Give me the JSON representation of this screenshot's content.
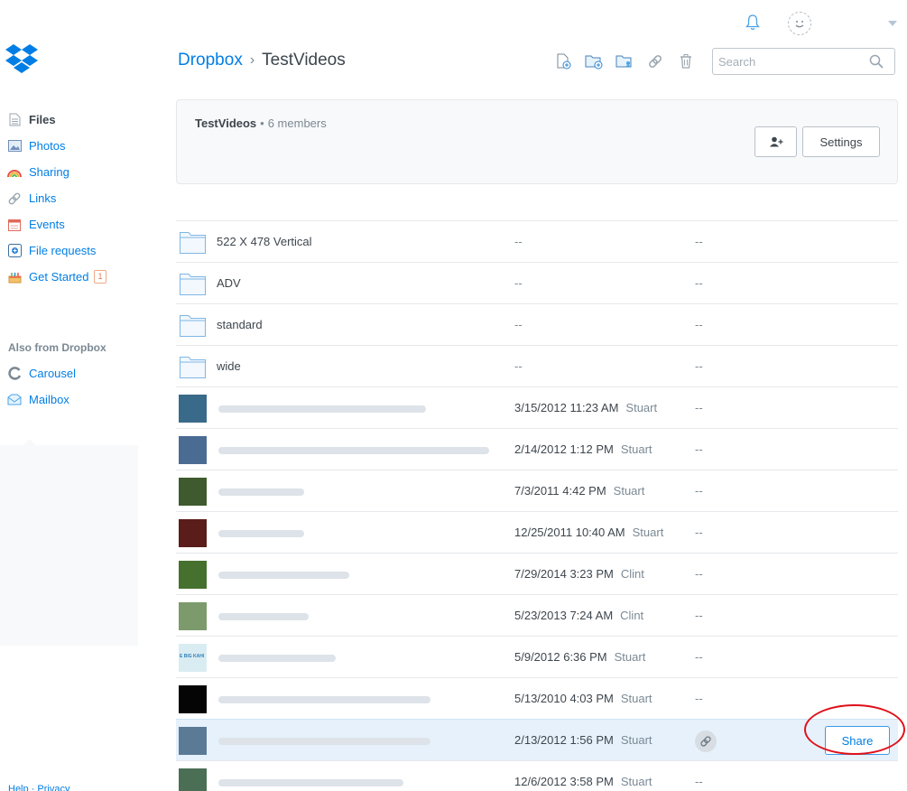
{
  "app": {
    "name": "Dropbox"
  },
  "colors": {
    "accent": "#007ee5",
    "selected_row": "#e6f1fb",
    "annotation_ring": "#e0101a"
  },
  "topbar": {
    "icons": [
      "bell-icon",
      "avatar",
      "chevron-down-icon"
    ]
  },
  "sidebar": {
    "items": [
      {
        "label": "Files",
        "icon": "file-icon",
        "active": true
      },
      {
        "label": "Photos",
        "icon": "photo-icon"
      },
      {
        "label": "Sharing",
        "icon": "rainbow-icon"
      },
      {
        "label": "Links",
        "icon": "link-icon"
      },
      {
        "label": "Events",
        "icon": "calendar-icon"
      },
      {
        "label": "File requests",
        "icon": "file-request-icon"
      },
      {
        "label": "Get Started",
        "icon": "cake-icon",
        "badge": "1"
      }
    ],
    "also_heading": "Also from Dropbox",
    "also_items": [
      {
        "label": "Carousel",
        "icon": "carousel-icon"
      },
      {
        "label": "Mailbox",
        "icon": "mailbox-icon"
      }
    ],
    "footer_text": "Help · Privacy"
  },
  "header": {
    "breadcrumb_root": "Dropbox",
    "breadcrumb_separator": "›",
    "breadcrumb_current": "TestVideos",
    "tools": [
      "upload-file-icon",
      "new-folder-icon",
      "shared-folder-icon",
      "link-icon",
      "trash-icon"
    ],
    "search_placeholder": "Search"
  },
  "banner": {
    "folder_name": "TestVideos",
    "separator": "•",
    "members": "6 members",
    "invite_icon": "add-member-icon",
    "settings_label": "Settings"
  },
  "files": [
    {
      "type": "folder",
      "name": "522 X 478 Vertical",
      "modified": "--",
      "who": "",
      "shared": "--"
    },
    {
      "type": "folder",
      "name": "ADV",
      "modified": "--",
      "who": "",
      "shared": "--"
    },
    {
      "type": "folder",
      "name": "standard",
      "modified": "--",
      "who": "",
      "shared": "--"
    },
    {
      "type": "folder",
      "name": "wide",
      "modified": "--",
      "who": "",
      "shared": "--"
    },
    {
      "type": "video",
      "modified": "3/15/2012 11:23 AM",
      "who": "Stuart",
      "shared": "--",
      "thumb": "#3a6a8a"
    },
    {
      "type": "video",
      "modified": "2/14/2012 1:12 PM",
      "who": "Stuart",
      "shared": "--",
      "thumb": "#4a6c93"
    },
    {
      "type": "video",
      "modified": "7/3/2011 4:42 PM",
      "who": "Stuart",
      "shared": "--",
      "thumb": "#3f5a2e"
    },
    {
      "type": "video",
      "modified": "12/25/2011 10:40 AM",
      "who": "Stuart",
      "shared": "--",
      "thumb": "#5a1d1a"
    },
    {
      "type": "video",
      "modified": "7/29/2014 3:23 PM",
      "who": "Clint",
      "shared": "--",
      "thumb": "#46702e"
    },
    {
      "type": "video",
      "modified": "5/23/2013 7:24 AM",
      "who": "Clint",
      "shared": "--",
      "thumb": "#7c9a6c"
    },
    {
      "type": "video",
      "modified": "5/9/2012 6:36 PM",
      "who": "Stuart",
      "shared": "--",
      "thumb": "#d9ecf2",
      "thumb_text": "E BIG KAHI"
    },
    {
      "type": "video",
      "modified": "5/13/2010 4:03 PM",
      "who": "Stuart",
      "shared": "--",
      "thumb": "#050505"
    },
    {
      "type": "video",
      "modified": "2/13/2012 1:56 PM",
      "who": "Stuart",
      "shared": "link",
      "thumb": "#5a7a96",
      "selected": true,
      "action": "Share"
    },
    {
      "type": "video",
      "modified": "12/6/2012 3:58 PM",
      "who": "Stuart",
      "shared": "--",
      "thumb": "#4a6f55"
    }
  ]
}
